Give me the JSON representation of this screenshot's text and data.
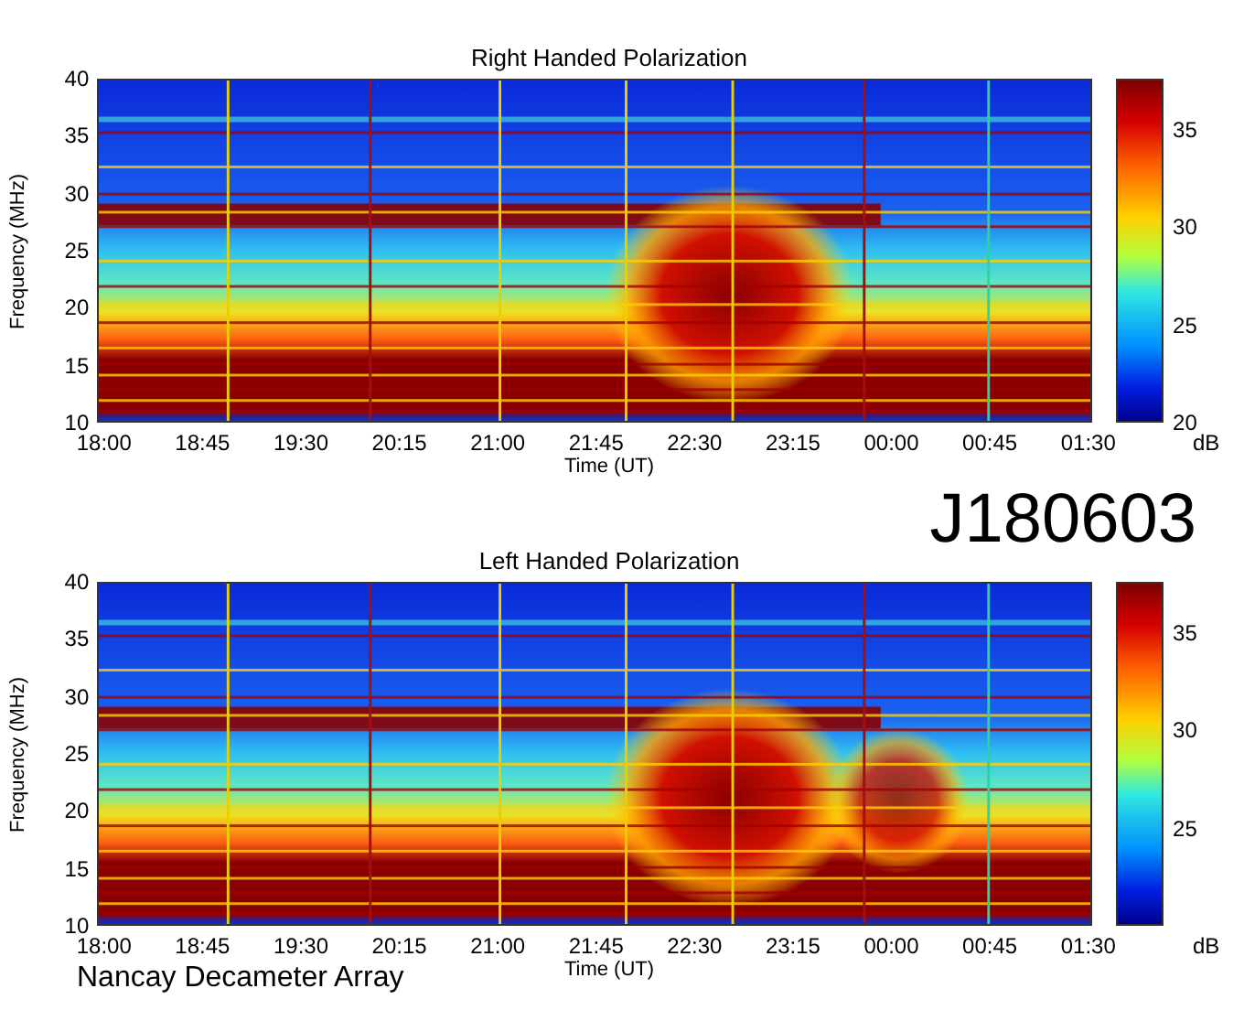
{
  "panels": [
    {
      "title": "Right Handed Polarization",
      "ylabel": "Frequency (MHz)",
      "yticks": [
        "40",
        "35",
        "30",
        "25",
        "20",
        "15",
        "10"
      ],
      "xticks": [
        "18:00",
        "18:45",
        "19:30",
        "20:15",
        "21:00",
        "21:45",
        "22:30",
        "23:15",
        "00:00",
        "00:45",
        "01:30"
      ],
      "xlabel": "Time (UT)",
      "colorbar": {
        "ticks": [
          "35",
          "30",
          "25",
          "20"
        ],
        "unit": "dB"
      }
    },
    {
      "title": "Left Handed Polarization",
      "ylabel": "Frequency (MHz)",
      "yticks": [
        "40",
        "35",
        "30",
        "25",
        "20",
        "15",
        "10"
      ],
      "xticks": [
        "18:00",
        "18:45",
        "19:30",
        "20:15",
        "21:00",
        "21:45",
        "22:30",
        "23:15",
        "00:00",
        "00:45",
        "01:30"
      ],
      "xlabel": "Time (UT)",
      "colorbar": {
        "ticks": [
          "35",
          "30",
          "25"
        ],
        "unit": "dB"
      }
    }
  ],
  "code": "J180603",
  "footer": "Nancay Decameter Array"
}
